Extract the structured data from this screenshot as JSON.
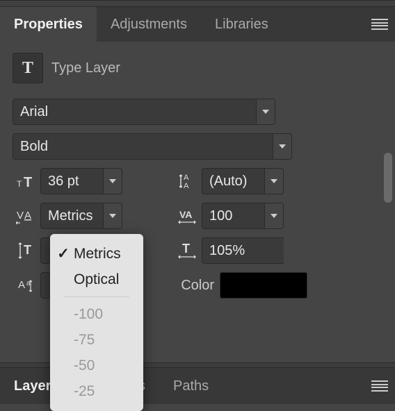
{
  "tabs": {
    "top": [
      "Properties",
      "Adjustments",
      "Libraries"
    ],
    "bottom": [
      "Layers",
      "Channels",
      "Paths"
    ]
  },
  "layer": {
    "icon_letter": "T",
    "label": "Type Layer"
  },
  "font": {
    "family": "Arial",
    "style": "Bold"
  },
  "fields": {
    "font_size": "36 pt",
    "leading": "(Auto)",
    "kerning": "Metrics",
    "tracking": "100",
    "height_scale": "105%"
  },
  "color": {
    "label": "Color",
    "value": "#000000"
  },
  "dropdown": {
    "items": [
      "Metrics",
      "Optical"
    ],
    "selected": "Metrics",
    "presets": [
      "-100",
      "-75",
      "-50",
      "-25"
    ]
  }
}
